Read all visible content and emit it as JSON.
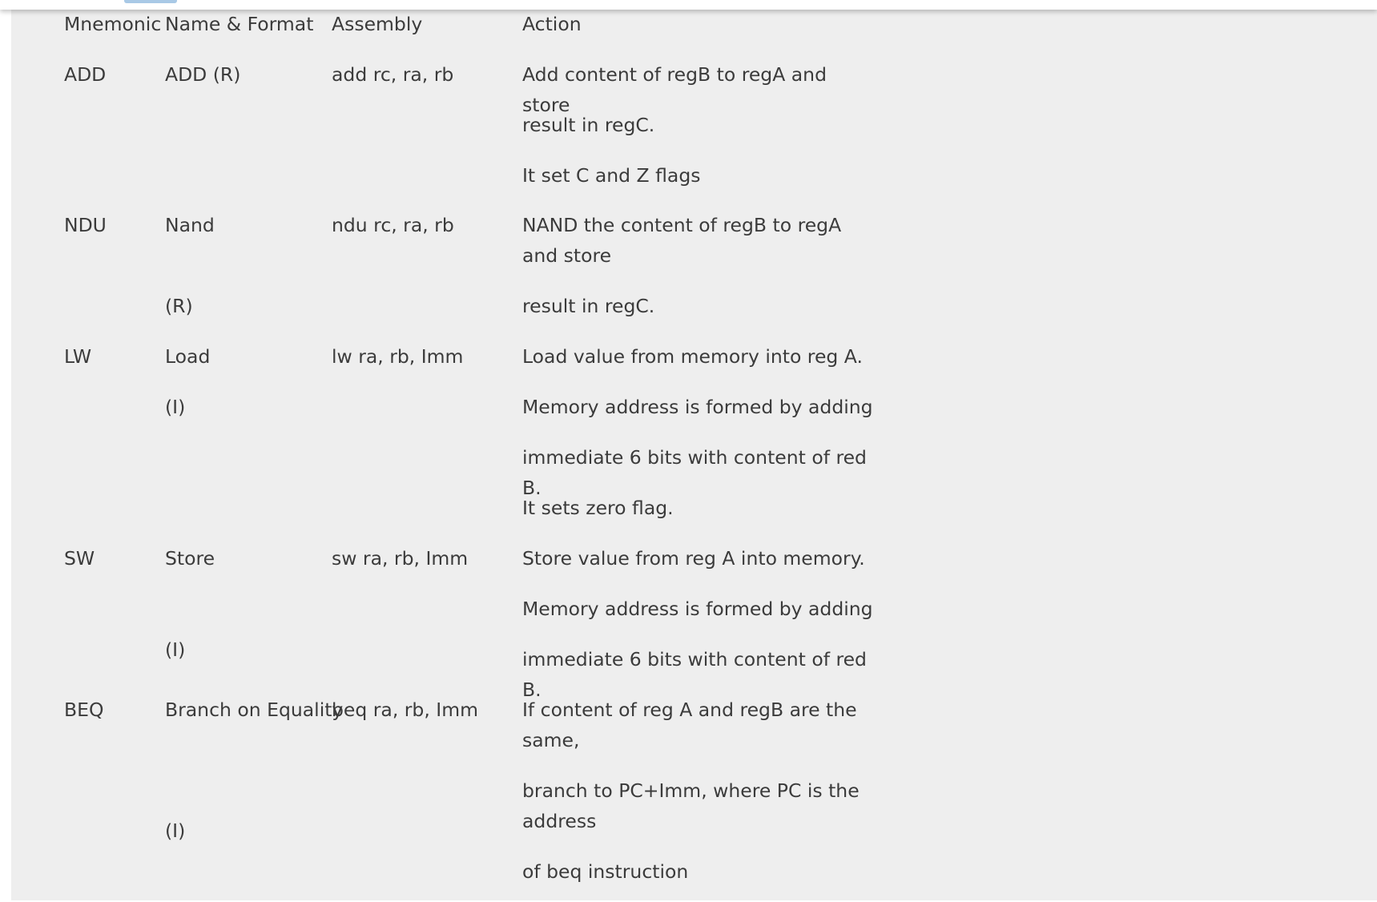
{
  "columns": {
    "mnemonic": "Mnemonic",
    "name_format": "Name & Format",
    "assembly": "Assembly",
    "action": "Action"
  },
  "rows": [
    {
      "mnemonic": "ADD",
      "name": "ADD (R)",
      "assembly": "add rc, ra, rb",
      "actions": [
        "Add content of regB to regA and store",
        "result in regC.",
        "It set C and Z flags"
      ]
    },
    {
      "mnemonic": "NDU",
      "name": "Nand",
      "format": "(R)",
      "assembly": "ndu rc, ra, rb",
      "actions": [
        "NAND the content of regB to regA and store",
        "result in regC."
      ]
    },
    {
      "mnemonic": "LW",
      "name": "Load",
      "format": "(I)",
      "assembly": "lw ra, rb, Imm",
      "actions": [
        "Load value from memory into reg A.",
        "Memory address is formed by adding",
        "immediate 6 bits with content of red B.",
        "It sets zero flag."
      ]
    },
    {
      "mnemonic": "SW",
      "name": "Store",
      "format": "(I)",
      "assembly": "sw ra, rb, Imm",
      "actions": [
        "Store value from reg A into memory.",
        "Memory address is formed by adding",
        "immediate 6 bits with content of red B."
      ]
    },
    {
      "mnemonic": "BEQ",
      "name": "Branch on Equality",
      "format": "(I)",
      "assembly": "beq ra, rb, Imm",
      "actions": [
        "If content of reg A and regB are the same,",
        "branch to PC+Imm, where PC is the address",
        "of beq instruction"
      ]
    }
  ]
}
